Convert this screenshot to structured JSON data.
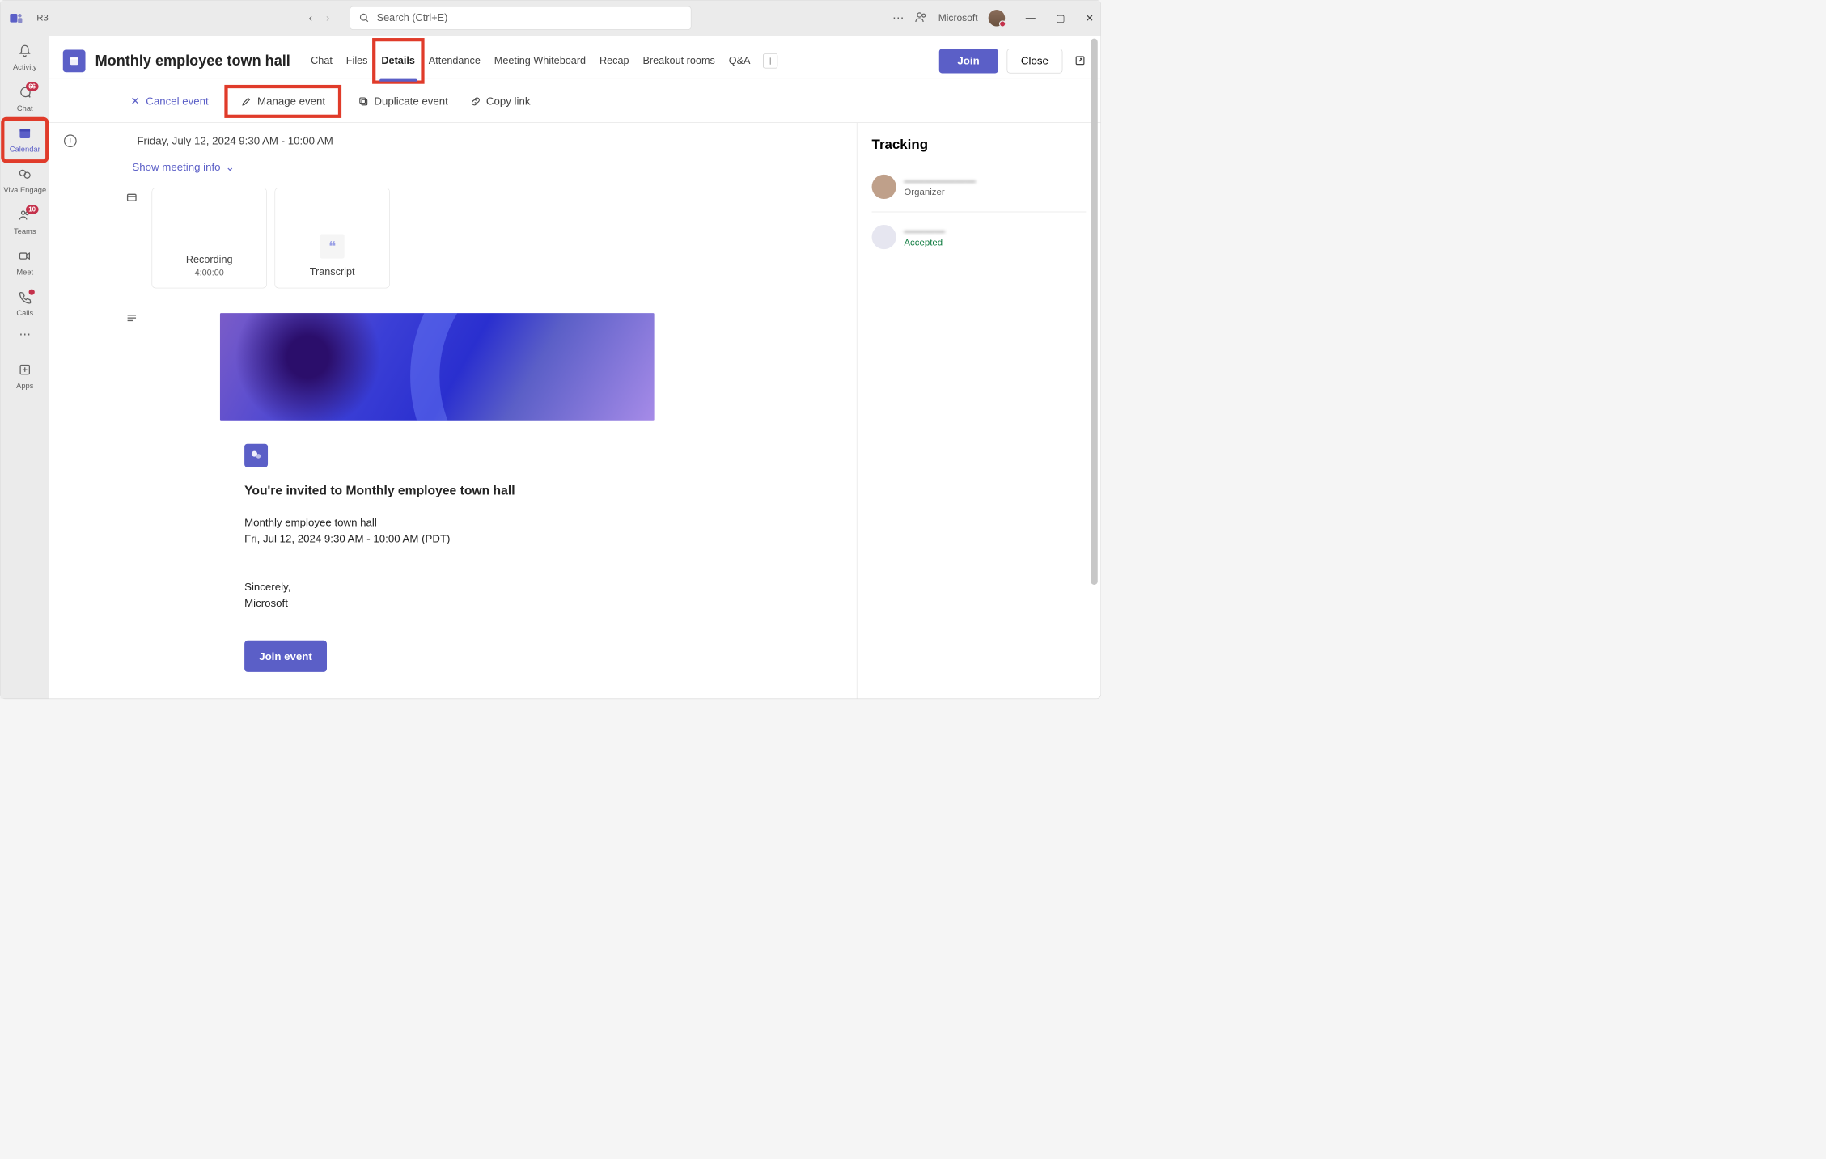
{
  "titlebar": {
    "env": "R3",
    "search_placeholder": "Search (Ctrl+E)",
    "account_label": "Microsoft"
  },
  "rail": {
    "activity": "Activity",
    "chat": "Chat",
    "chat_badge": "66",
    "calendar": "Calendar",
    "viva": "Viva Engage",
    "teams": "Teams",
    "teams_badge": "10",
    "meet": "Meet",
    "calls": "Calls",
    "apps": "Apps"
  },
  "header": {
    "title": "Monthly employee town hall",
    "tabs": [
      "Chat",
      "Files",
      "Details",
      "Attendance",
      "Meeting Whiteboard",
      "Recap",
      "Breakout rooms",
      "Q&A"
    ],
    "active_tab": "Details",
    "join": "Join",
    "close": "Close"
  },
  "actions": {
    "cancel": "Cancel event",
    "manage": "Manage event",
    "duplicate": "Duplicate event",
    "copylink": "Copy link"
  },
  "info": {
    "datetime": "Friday, July 12, 2024 9:30 AM - 10:00 AM",
    "show_meeting_info": "Show meeting info"
  },
  "cards": {
    "recording_title": "Recording",
    "recording_duration": "4:00:00",
    "transcript_title": "Transcript"
  },
  "invite": {
    "heading": "You're invited to Monthly employee town hall",
    "line1": "Monthly employee town hall",
    "line2": "Fri, Jul 12, 2024 9:30 AM - 10:00 AM (PDT)",
    "signoff1": "Sincerely,",
    "signoff2": "Microsoft",
    "join_label": "Join event"
  },
  "tracking": {
    "title": "Tracking",
    "people": [
      {
        "name": "———————",
        "role": "Organizer"
      },
      {
        "name": "————",
        "role": "Accepted"
      }
    ]
  }
}
